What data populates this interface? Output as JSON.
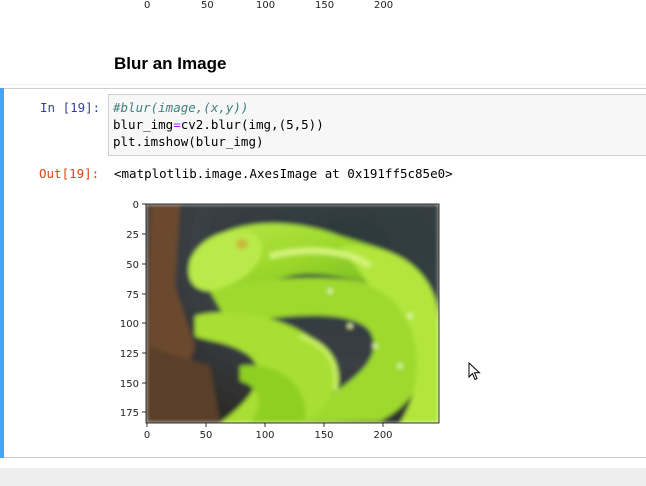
{
  "top_axis": {
    "ticks": [
      "0",
      "50",
      "100",
      "150",
      "200"
    ]
  },
  "markdown": {
    "heading": "Blur an Image"
  },
  "cell": {
    "in_prompt": "In [19]:",
    "code": {
      "line1": "#blur(image,(x,y))",
      "line2_a": "blur_img",
      "line2_op": "=",
      "line2_b": "cv2.blur(img,(5,5))",
      "line3": "plt.imshow(blur_img)"
    },
    "out_prompt": "Out[19]:",
    "output_text": "<matplotlib.image.AxesImage at 0x191ff5c85e0>",
    "plot": {
      "y_ticks": [
        "0",
        "25",
        "50",
        "75",
        "100",
        "125",
        "150",
        "175"
      ],
      "x_ticks": [
        "0",
        "50",
        "100",
        "150",
        "200"
      ],
      "image_description_icon": "blurred-snake-image"
    }
  },
  "colors": {
    "cell_bar": "#42a5f5",
    "in_prompt": "#303f9f",
    "out_prompt": "#d84315",
    "comment": "#408080"
  }
}
